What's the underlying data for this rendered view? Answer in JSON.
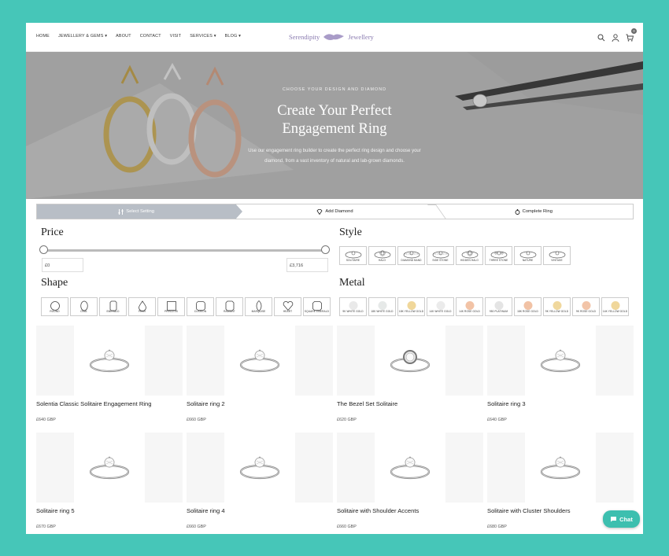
{
  "nav": {
    "items": [
      "HOME",
      "JEWELLERY & GEMS ▾",
      "ABOUT",
      "CONTACT",
      "VISIT",
      "SERVICES ▾",
      "BLOG ▾"
    ]
  },
  "logo": {
    "left": "Serendipity",
    "right": "Jewellery"
  },
  "cart": {
    "count": "0"
  },
  "hero": {
    "kicker": "CHOOSE YOUR DESIGN AND DIAMOND",
    "title_line1": "Create Your Perfect",
    "title_line2": "Engagement Ring",
    "subtitle_line1": "Use our engagement ring builder to create the perfect ring design and choose your",
    "subtitle_line2": "diamond, from a vast inventory of natural and lab-grown diamonds."
  },
  "steps": [
    "Select Setting",
    "Add Diamond",
    "Complete Ring"
  ],
  "filters": {
    "price_title": "Price",
    "price_min": "£0",
    "price_max": "£3,716",
    "style_title": "Style",
    "styles": [
      "SOLITAIRE",
      "HALO",
      "DIAMOND BAND",
      "SIDE STONE",
      "HIDDEN HALO",
      "THREE STONE",
      "NATURE",
      "VINTAGE"
    ],
    "shape_title": "Shape",
    "shapes": [
      "ROUND",
      "OVAL",
      "EMERALD",
      "PEAR",
      "PRINCESS",
      "CUSHION",
      "RADIANT",
      "MARQUISE",
      "HEART",
      "SQUARE EMERALD"
    ],
    "metal_title": "Metal",
    "metals": [
      {
        "label": "9K WHITE GOLD",
        "color": "#e9e9e9"
      },
      {
        "label": "18K WHITE GOLD",
        "color": "#e6e9e8"
      },
      {
        "label": "18K YELLOW GOLD",
        "color": "#f0d79a"
      },
      {
        "label": "14K WHITE GOLD",
        "color": "#ebebeb"
      },
      {
        "label": "14K ROSE GOLD",
        "color": "#f2c3a6"
      },
      {
        "label": "950 PLATINUM",
        "color": "#e4e4e4"
      },
      {
        "label": "18K ROSE GOLD",
        "color": "#f1c2a5"
      },
      {
        "label": "9K YELLOW GOLD",
        "color": "#f0d89d"
      },
      {
        "label": "9K ROSE GOLD",
        "color": "#f2c4a8"
      },
      {
        "label": "14K YELLOW GOLD",
        "color": "#f0d79b"
      }
    ]
  },
  "products": [
    {
      "name": "Solentia Classic Solitaire Engagement Ring",
      "price": "£640 GBP"
    },
    {
      "name": "Solitaire ring 2",
      "price": "£660 GBP"
    },
    {
      "name": "The Bezel Set Solitaire",
      "price": "£620 GBP"
    },
    {
      "name": "Solitaire ring 3",
      "price": "£640 GBP"
    },
    {
      "name": "Solitaire ring 5",
      "price": "£670 GBP"
    },
    {
      "name": "Solitaire ring 4",
      "price": "£660 GBP"
    },
    {
      "name": "Solitaire with Shoulder Accents",
      "price": "£660 GBP"
    },
    {
      "name": "Solitaire with Cluster Shoulders",
      "price": "£680 GBP"
    }
  ],
  "chat": {
    "label": "Chat"
  }
}
